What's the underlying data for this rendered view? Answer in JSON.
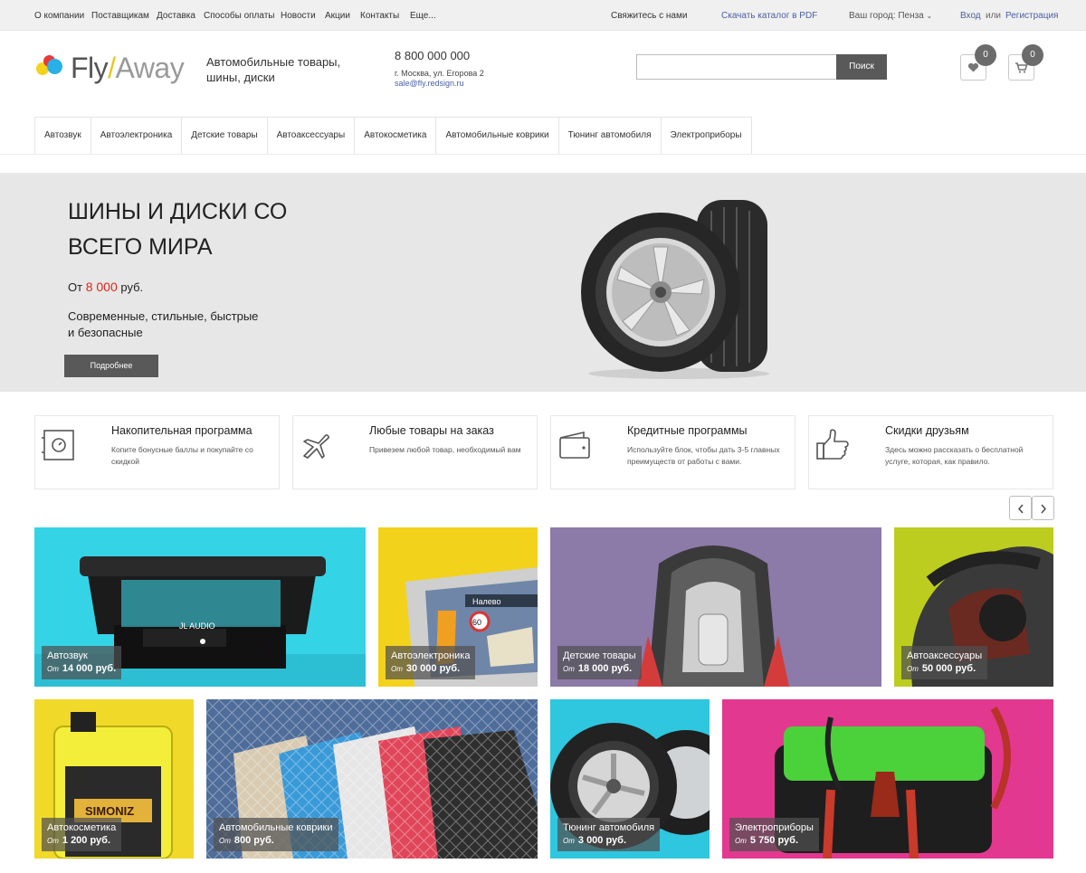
{
  "topbar": {
    "menu": [
      "О компании",
      "Поставщикам",
      "Доставка",
      "Способы оплаты",
      "Новости",
      "Акции",
      "Контакты",
      "Еще..."
    ],
    "contact": "Свяжитесь с нами",
    "catalog_pdf": "Скачать каталог в PDF",
    "city": "Ваш город: Пенза",
    "login": "Вход",
    "or": "или",
    "register": "Регистрация"
  },
  "header": {
    "logo_fly": "Fly",
    "logo_slash": "/",
    "logo_away": "Away",
    "tagline": "Автомобильные товары, шины, диски",
    "phone": "8 800 000 000",
    "address": "г. Москва, ул. Егорова 2",
    "email": "sale@fly.redsign.ru",
    "search_placeholder": "",
    "search_button": "Поиск",
    "favorites_count": "0",
    "cart_count": "0"
  },
  "catnav": [
    "Автозвук",
    "Автоэлектроника",
    "Детские товары",
    "Автоаксессуары",
    "Автокосметика",
    "Автомобильные коврики",
    "Тюнинг автомобиля",
    "Электроприборы"
  ],
  "banner": {
    "title": "ШИНЫ И ДИСКИ СО ВСЕГО МИРА",
    "price_prefix": "От",
    "price_value": "8 000",
    "price_suffix": "руб.",
    "description": "Современные, стильные, быстрые и безопасные",
    "button": "Подробнее"
  },
  "features": [
    {
      "icon": "safe-icon",
      "title": "Накопительная программа",
      "text": "Копите бонусные баллы и покупайте со скидкой"
    },
    {
      "icon": "airplane-icon",
      "title": "Любые товары на заказ",
      "text": "Привезем любой товар, необходимый вам"
    },
    {
      "icon": "wallet-icon",
      "title": "Кредитные программы",
      "text": "Используйте блок, чтобы дать 3-5 главных преимуществ от работы с вами."
    },
    {
      "icon": "thumbs-up-icon",
      "title": "Скидки друзьям",
      "text": "Здесь можно рассказать о бесплатной услуге, которая, как правило."
    }
  ],
  "tiles": [
    {
      "name": "Автозвук",
      "from": "От",
      "price": "14 000 руб.",
      "bg": "#35d3e6"
    },
    {
      "name": "Автоэлектроника",
      "from": "От",
      "price": "30 000 руб.",
      "bg": "#f3d21c"
    },
    {
      "name": "Детские товары",
      "from": "От",
      "price": "18 000 руб.",
      "bg": "#8c7aa8"
    },
    {
      "name": "Автоаксессуары",
      "from": "От",
      "price": "50 000 руб.",
      "bg": "#bccd1f"
    },
    {
      "name": "Автокосметика",
      "from": "От",
      "price": "1 200 руб.",
      "bg": "#f1d92a"
    },
    {
      "name": "Автомобильные коврики",
      "from": "От",
      "price": "800 руб.",
      "bg": "#4f6d9a"
    },
    {
      "name": "Тюнинг автомобиля",
      "from": "От",
      "price": "3 000 руб.",
      "bg": "#2fc6df"
    },
    {
      "name": "Электроприборы",
      "from": "От",
      "price": "5 750 руб.",
      "bg": "#e2388f"
    }
  ],
  "tile_art": {
    "audio_brand": "JL AUDIO",
    "nav_text": "Налево",
    "speed": "60",
    "cosmetic_brand": "SIMONIZ"
  }
}
